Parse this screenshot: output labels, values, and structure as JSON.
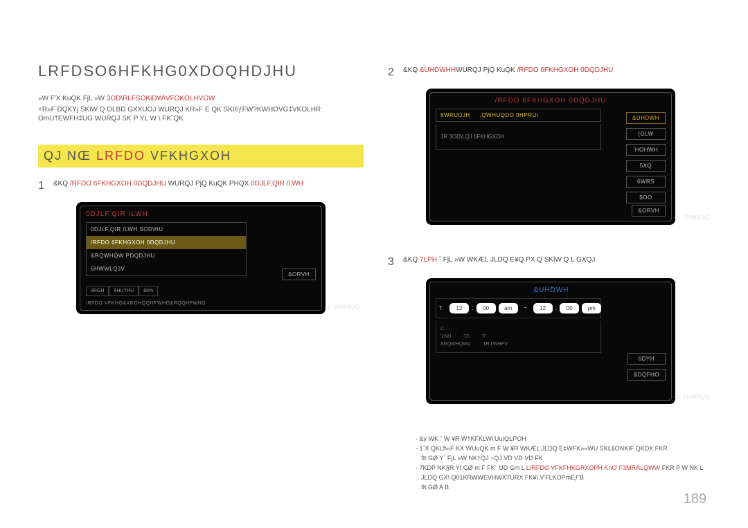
{
  "page": {
    "number": "189",
    "title": "LRFDSO6HFKHG0XDOQHDJHU",
    "note_prefix": "»W F'X KuQK FjL  »W",
    "note_hl": "3OD\\RLFSOKiDW\\VFOKOLHVGW",
    "desc": "+R»F ĐQKYj SKiW Q OLBD GXXUOJ WURQJ KR»F E   QK SKI6ƒFW?KWHOVG‡VKOLHR OmU†EWFH‡UG   WURQJ SK˙P YL   W \\ FK˘QK",
    "section": {
      "prefix": "QJ NŒ ",
      "red": "LRFDO",
      "rest": " VFKHGXOH"
    },
    "step1": {
      "pre": "&KQ ",
      "kw": "/RFDO 6FKHGXOH 0DQDJHU",
      "mid": " WURQJ PjQ KuQK PHQX ",
      "kw2": "0DJLF,QIR /LWH"
    },
    "step2": {
      "pre": "&KQ ",
      "kw": "&UHDWHH",
      "mid": "WURQJ PjQ KuQK ",
      "kw2": "/RFDO 6FKHGXOH 0DQDJHU"
    },
    "step3": {
      "pre": "&KQ ",
      "kw": "7LPH",
      "rest": "  ˇ FjL  »W WKÆL JLDQ E¥Q PX Q SKiW Q L GXQJ"
    }
  },
  "panel1": {
    "title": "0DJLF,QIR /LWH",
    "items": {
      "0": "0DJLF,QIR /LWH SOD\\HU",
      "1": "/RFDO 6FKHGXOH 0DQDJHU",
      "2": "&RQWHQW PDQDJHU",
      "3": "6HWWLQJV"
    },
    "close": "&ORVH",
    "stat": {
      "mode": "0RGH",
      "server": "6HUYHU",
      "usb": "86%"
    },
    "statusline": "/RFDO VFKHG&XROHQQHFWHG&RQQHFWHG",
    "return": "5HWXUQ"
  },
  "panel2": {
    "title": "/RFDO 6FKHGXOH 0DQDJHU",
    "tabs": {
      "0": "6WRUDJH",
      "1": ",QWHUQDO 0HPRU\\"
    },
    "empty": "1R 3OD\\LQJ 6FKHGXOH",
    "sidebtn": {
      "0": "&UHDWH",
      "1": "(GLW",
      "2": "'HOHWH",
      "3": "5XQ",
      "4": "6WRS",
      "5": "$OO"
    },
    "close": "&ORVH",
    "return": "5HWXUQ"
  },
  "panel3": {
    "title": "&UHDWH",
    "row_label_t": "T",
    "row_label_c": "C",
    "time": {
      "h1": "12",
      "m1": "00",
      "ap1": "am",
      "h2": "12",
      "m2": "00",
      "ap2": "pm"
    },
    "meta": {
      "r1a": "'LNH",
      "r1b": "'D\\",
      "r1c": "'7'",
      "r2a": "&RQWHQWV",
      "r2b": "1R LWHPV"
    },
    "save": "6DYH",
    "cancel": "&DQFHO",
    "return": "5HWXUQ"
  },
  "footnotes": {
    "f1": "- &y WK ˇ W ¥R   W†KFKLW\\'UuIQLPOH",
    "f2a": "- 1˝X QKLħ«F KX WUuQK  m F W ¥R  WKÆL JLDQ E‡WFK»«WU SKL§ONKIF QKDX FKR",
    "f2b": "9t GØ Y˙ FjL  »W NK†QJ ~QJ              VD                    VD                     VD              FK",
    "f3_pre": "- 7KDP NK§R Yt GØ  m F FK˙ UD Gm L ",
    "f3_kw": "L/RFDO VFKFHKGRXOPH KnƠ F3MRALQWW",
    "f3_post": " FKR P W NK L",
    "f4": "JLDQ GX\\ Q01KRWWEVHWXTURX FK¥\\ V'FLKOPmEƒ'B",
    "f5": "9t GØ   A                        B"
  }
}
